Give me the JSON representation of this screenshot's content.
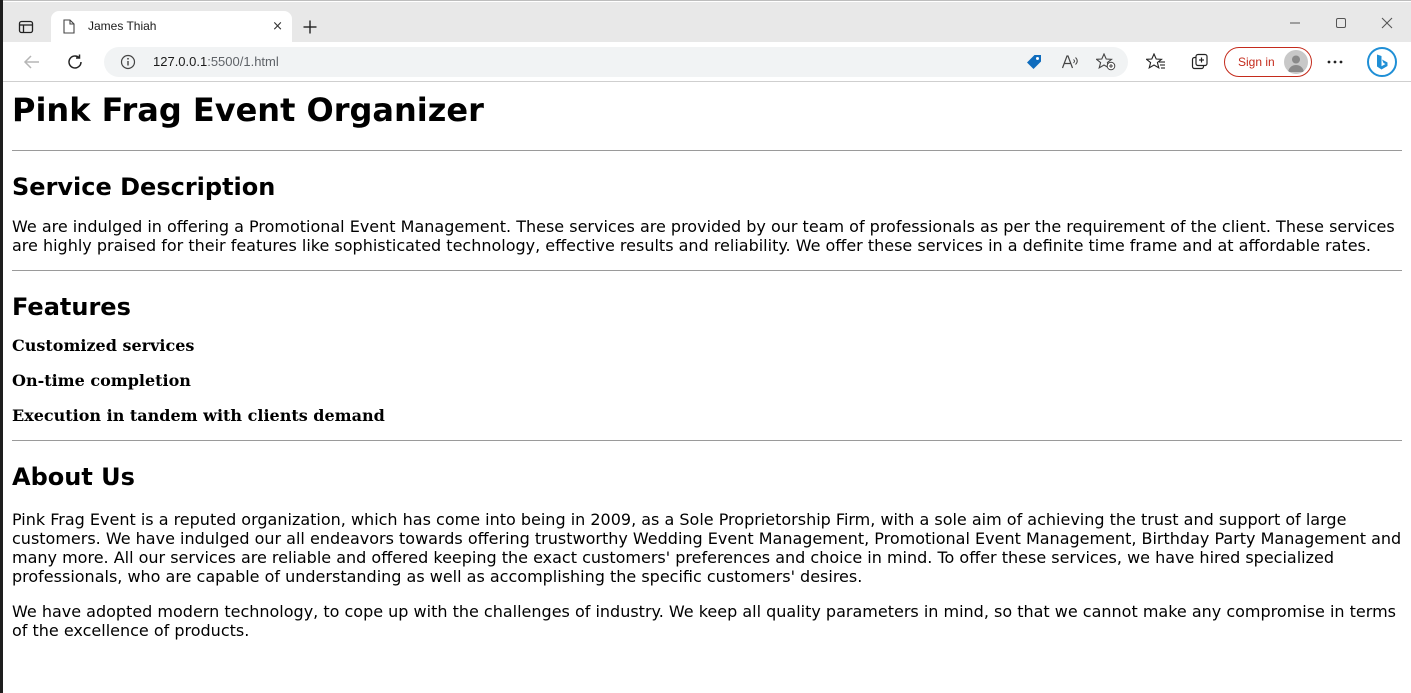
{
  "tab": {
    "title": "James Thiah",
    "close_glyph": "×"
  },
  "newtab_glyph": "+",
  "address": {
    "host": "127.0.0.1",
    "rest": ":5500/1.html"
  },
  "signin_label": "Sign in",
  "icons": {
    "tab_actions": "tab-actions-icon",
    "page": "page-icon",
    "back": "back-arrow-icon",
    "reload": "reload-icon",
    "info": "info-icon",
    "coupon": "tag-icon",
    "read_aloud": "read-aloud-icon",
    "favorite_add": "star-plus-icon",
    "favorites": "favorites-icon",
    "collections": "collections-icon",
    "more": "more-icon",
    "bing": "bing-icon"
  },
  "colors": {
    "accent_blue": "#0f6cbd",
    "signin_red": "#c42b1c"
  },
  "page": {
    "title": "Pink Frag Event Organizer",
    "service": {
      "heading": "Service Description",
      "text": "We are indulged in offering a Promotional Event Management. These services are provided by our team of professionals as per the requirement of the client. These services are highly praised for their features like sophisticated technology, effective results and reliability. We offer these services in a definite time frame and at affordable rates."
    },
    "features": {
      "heading": "Features",
      "items": [
        "Customized services",
        "On-time completion",
        "Execution in tandem with clients demand"
      ]
    },
    "about": {
      "heading": "About Us",
      "p1": "Pink Frag Event is a reputed organization, which has come into being in 2009, as a Sole Proprietorship Firm, with a sole aim of achieving the trust and support of large customers. We have indulged our all endeavors towards offering trustworthy Wedding Event Management, Promotional Event Management, Birthday Party Management and many more. All our services are reliable and offered keeping the exact customers' preferences and choice in mind. To offer these services, we have hired specialized professionals, who are capable of understanding as well as accomplishing the specific customers' desires.",
      "p2": "We have adopted modern technology, to cope up with the challenges of industry. We keep all quality parameters in mind, so that we cannot make any compromise in terms of the excellence of products."
    }
  }
}
